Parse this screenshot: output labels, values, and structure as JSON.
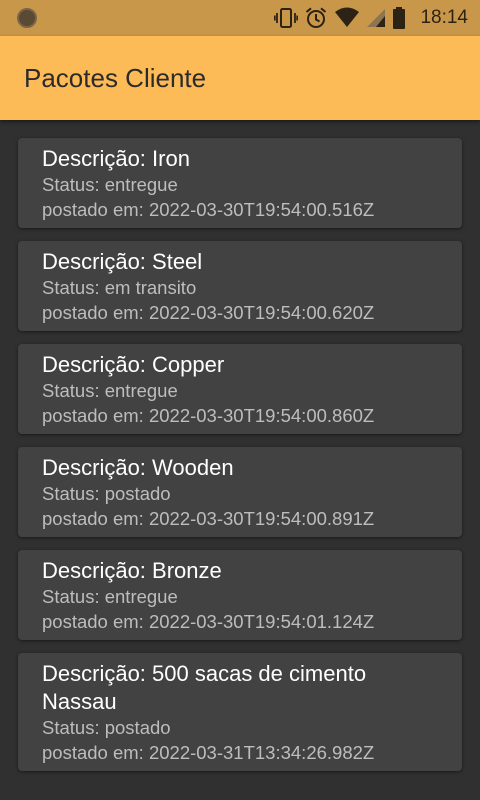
{
  "status_bar": {
    "time": "18:14",
    "icons": [
      "notification-circle-icon",
      "vibrate-icon",
      "alarm-icon",
      "wifi-icon",
      "signal-icon",
      "battery-icon"
    ]
  },
  "app_bar": {
    "title": "Pacotes Cliente",
    "color": "#fdbb57"
  },
  "packages": [
    {
      "title": "Descrição: Iron",
      "status": "Status: entregue",
      "posted": "postado em: 2022-03-30T19:54:00.516Z"
    },
    {
      "title": "Descrição: Steel",
      "status": "Status: em transito",
      "posted": "postado em: 2022-03-30T19:54:00.620Z"
    },
    {
      "title": "Descrição: Copper",
      "status": "Status: entregue",
      "posted": "postado em: 2022-03-30T19:54:00.860Z"
    },
    {
      "title": "Descrição: Wooden",
      "status": "Status: postado",
      "posted": "postado em: 2022-03-30T19:54:00.891Z"
    },
    {
      "title": "Descrição: Bronze",
      "status": "Status: entregue",
      "posted": "postado em: 2022-03-30T19:54:01.124Z"
    },
    {
      "title": "Descrição: 500 sacas de cimento Nassau",
      "status": "Status: postado",
      "posted": "postado em: 2022-03-31T13:34:26.982Z"
    }
  ]
}
